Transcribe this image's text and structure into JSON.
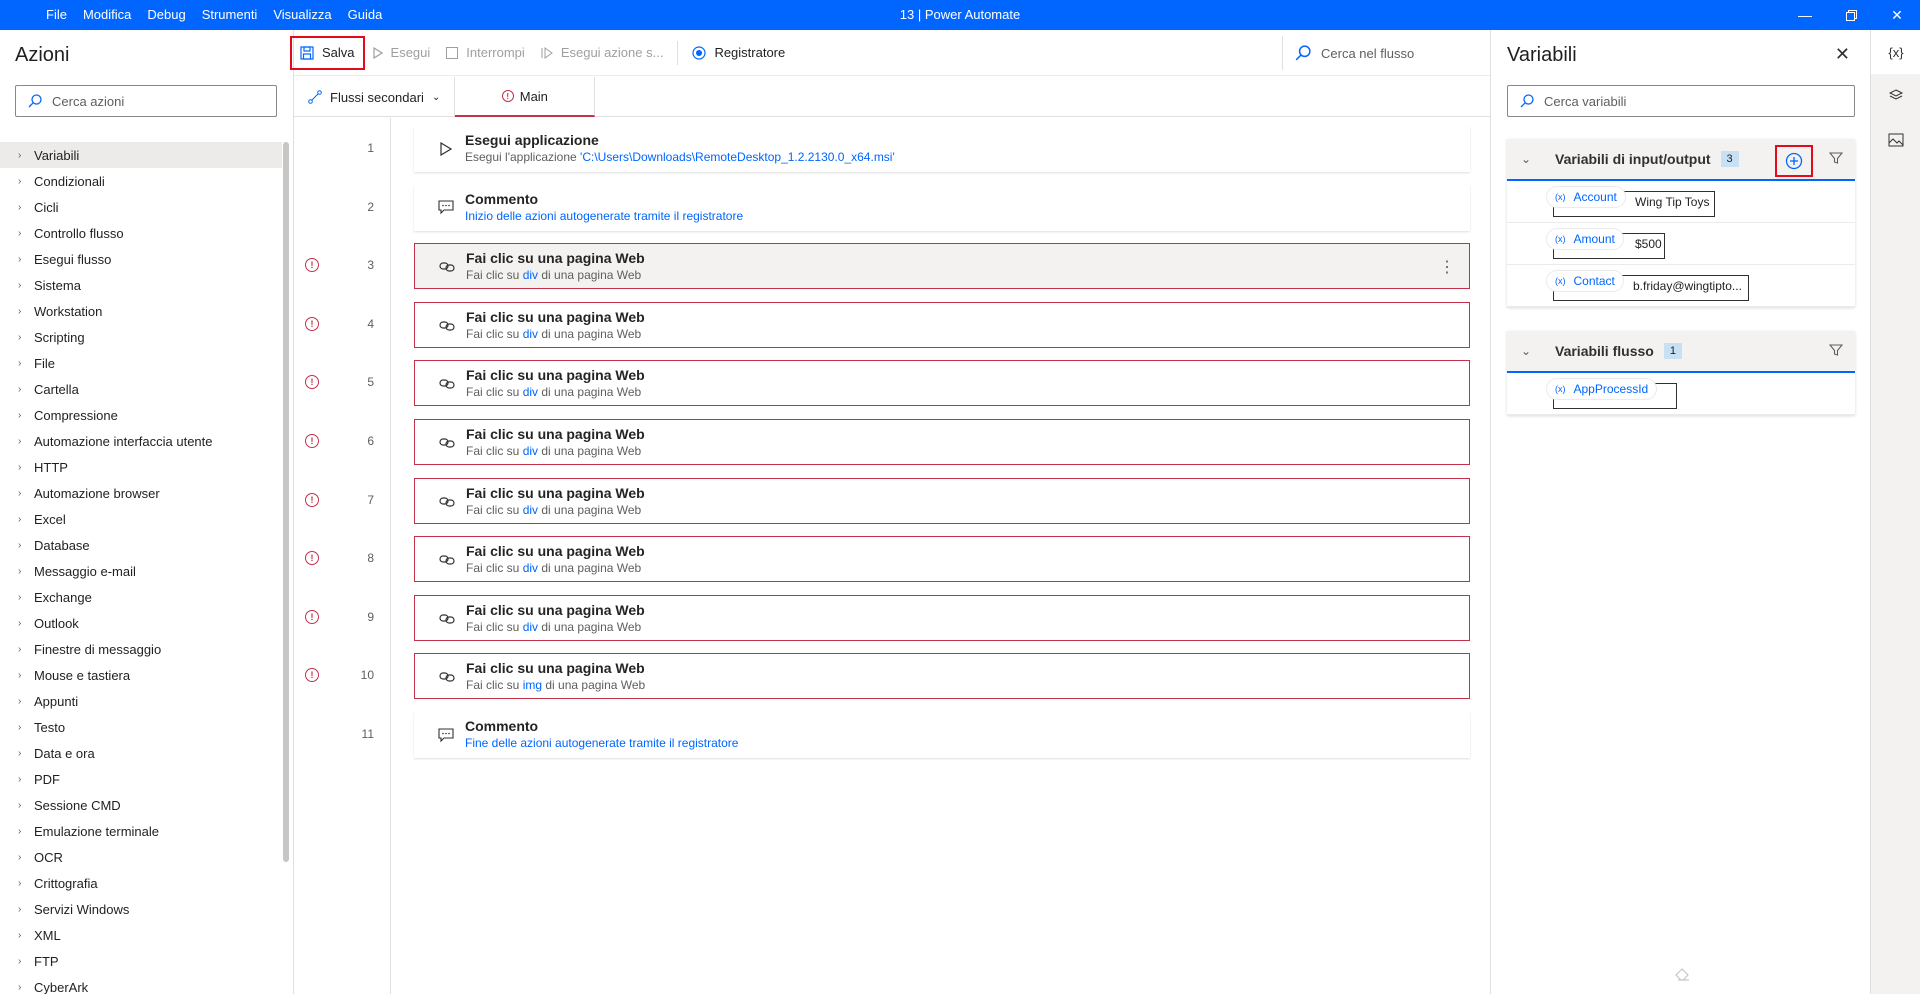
{
  "menu": [
    "File",
    "Modifica",
    "Debug",
    "Strumenti",
    "Visualizza",
    "Guida"
  ],
  "window_title": "13 | Power Automate",
  "actions_panel": {
    "title": "Azioni",
    "search_placeholder": "Cerca azioni",
    "categories": [
      "Variabili",
      "Condizionali",
      "Cicli",
      "Controllo flusso",
      "Esegui flusso",
      "Sistema",
      "Workstation",
      "Scripting",
      "File",
      "Cartella",
      "Compressione",
      "Automazione interfaccia utente",
      "HTTP",
      "Automazione browser",
      "Excel",
      "Database",
      "Messaggio e-mail",
      "Exchange",
      "Outlook",
      "Finestre di messaggio",
      "Mouse e tastiera",
      "Appunti",
      "Testo",
      "Data e ora",
      "PDF",
      "Sessione CMD",
      "Emulazione terminale",
      "OCR",
      "Crittografia",
      "Servizi Windows",
      "XML",
      "FTP",
      "CyberArk"
    ]
  },
  "toolbar": {
    "save": "Salva",
    "run": "Esegui",
    "stop": "Interrompi",
    "run_next": "Esegui azione s...",
    "recorder": "Registratore",
    "search_placeholder": "Cerca nel flusso"
  },
  "tabs": {
    "subflows": "Flussi secondari",
    "main": "Main"
  },
  "flow": [
    {
      "num": "1",
      "icon": "play-icon",
      "title": "Esegui applicazione",
      "sub_prefix": "Esegui l'applicazione ",
      "sub_link": "'C:\\Users\\Downloads\\RemoteDesktop_1.2.2130.0_x64.msi'",
      "sub_suffix": "",
      "error": false
    },
    {
      "num": "2",
      "icon": "comment-icon",
      "title": "Commento",
      "sub_prefix": "",
      "sub_link": "Inizio delle azioni autogenerate tramite il registratore",
      "sub_suffix": "",
      "error": false
    },
    {
      "num": "3",
      "icon": "link-icon",
      "title": "Fai clic su una pagina Web",
      "sub_prefix": "Fai clic su ",
      "sub_link": "div",
      "sub_suffix": " di una pagina Web",
      "error": true
    },
    {
      "num": "4",
      "icon": "link-icon",
      "title": "Fai clic su una pagina Web",
      "sub_prefix": "Fai clic su ",
      "sub_link": "div",
      "sub_suffix": " di una pagina Web",
      "error": true
    },
    {
      "num": "5",
      "icon": "link-icon",
      "title": "Fai clic su una pagina Web",
      "sub_prefix": "Fai clic su ",
      "sub_link": "div",
      "sub_suffix": " di una pagina Web",
      "error": true
    },
    {
      "num": "6",
      "icon": "link-icon",
      "title": "Fai clic su una pagina Web",
      "sub_prefix": "Fai clic su ",
      "sub_link": "div",
      "sub_suffix": " di una pagina Web",
      "error": true
    },
    {
      "num": "7",
      "icon": "link-icon",
      "title": "Fai clic su una pagina Web",
      "sub_prefix": "Fai clic su ",
      "sub_link": "div",
      "sub_suffix": " di una pagina Web",
      "error": true
    },
    {
      "num": "8",
      "icon": "link-icon",
      "title": "Fai clic su una pagina Web",
      "sub_prefix": "Fai clic su ",
      "sub_link": "div",
      "sub_suffix": " di una pagina Web",
      "error": true
    },
    {
      "num": "9",
      "icon": "link-icon",
      "title": "Fai clic su una pagina Web",
      "sub_prefix": "Fai clic su ",
      "sub_link": "div",
      "sub_suffix": " di una pagina Web",
      "error": true
    },
    {
      "num": "10",
      "icon": "link-icon",
      "title": "Fai clic su una pagina Web",
      "sub_prefix": "Fai clic su ",
      "sub_link": "img",
      "sub_suffix": " di una pagina Web",
      "error": true
    },
    {
      "num": "11",
      "icon": "comment-icon",
      "title": "Commento",
      "sub_prefix": "",
      "sub_link": "Fine delle azioni autogenerate tramite il registratore",
      "sub_suffix": "",
      "error": false
    }
  ],
  "variables": {
    "title": "Variabili",
    "search_placeholder": "Cerca variabili",
    "io_section": {
      "title": "Variabili di input/output",
      "count": "3",
      "items": [
        {
          "name": "Account",
          "value": "Wing Tip Toys"
        },
        {
          "name": "Amount",
          "value": "$500"
        },
        {
          "name": "Contact",
          "value": "b.friday@wingtipto..."
        }
      ]
    },
    "flow_section": {
      "title": "Variabili flusso",
      "count": "1",
      "items": [
        {
          "name": "AppProcessId",
          "value": ""
        }
      ]
    }
  },
  "colors": {
    "accent": "#0066ff",
    "error": "#c4314b",
    "highlight": "#e00b1c"
  }
}
